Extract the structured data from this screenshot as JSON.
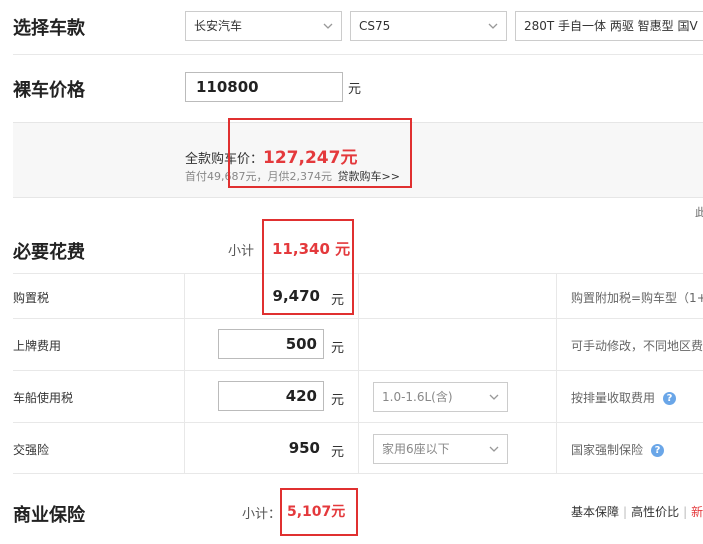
{
  "model_select": {
    "title": "选择车款",
    "brand": "长安汽车",
    "series": "CS75",
    "trim": "280T 手自一体 两驱 智惠型 国V"
  },
  "bare_price": {
    "title": "裸车价格",
    "value": "110800",
    "unit": "元"
  },
  "summary": {
    "total_label": "全款购车价：",
    "total_value": "127,247元",
    "loan_text": "首付49,687元，月供2,374元",
    "loan_link": "贷款购车>>",
    "edge_char": "此"
  },
  "necessary": {
    "title": "必要花费",
    "subtotal_label": "小计",
    "subtotal_value": "11,340 元",
    "rows": [
      {
        "label": "购置税",
        "amount": "9,470",
        "unit": "元",
        "note": "购置附加税=购车型（1+"
      },
      {
        "label": "上牌费用",
        "amount": "500",
        "unit": "元",
        "note": "可手动修改，不同地区费"
      },
      {
        "label": "车船使用税",
        "amount": "420",
        "unit": "元",
        "select": "1.0-1.6L(含)",
        "note": "按排量收取费用",
        "help": "?"
      },
      {
        "label": "交强险",
        "amount": "950",
        "unit": "元",
        "select": "家用6座以下",
        "note": "国家强制保险",
        "help": "?"
      }
    ]
  },
  "commercial": {
    "title": "商业保险",
    "subtotal_label": "小计：",
    "subtotal_value": "5,107元",
    "tabs": [
      "基本保障",
      "高性价比",
      "新手"
    ]
  },
  "colors": {
    "accent_red": "#e4393c",
    "highlight_box": "#e03030",
    "help_blue": "#6aa6e8"
  }
}
